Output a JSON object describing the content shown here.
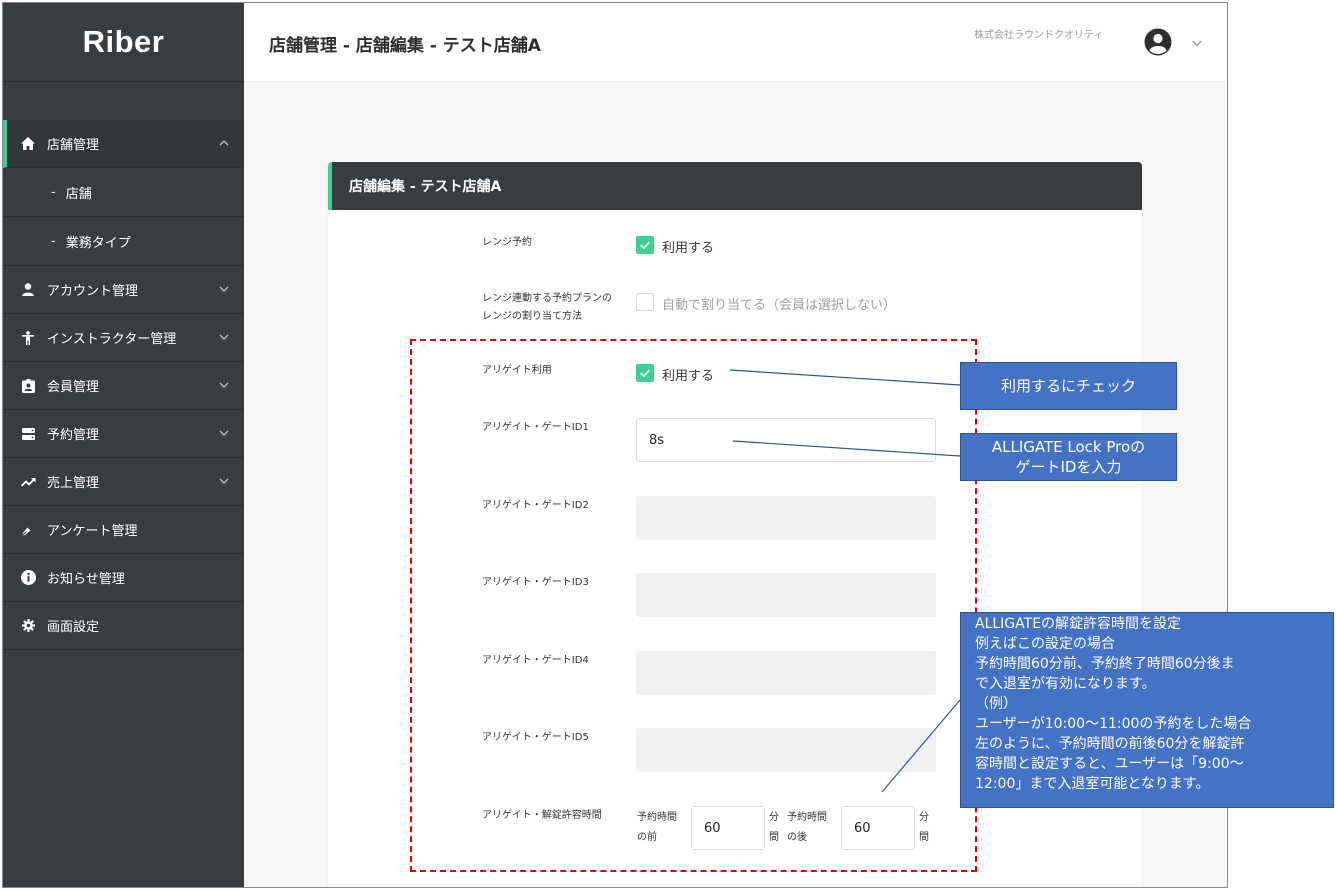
{
  "sidebar": {
    "brand": "Riber",
    "items": [
      {
        "label": "店舗管理",
        "icon": "home-icon"
      },
      {
        "label": "アカウント管理",
        "icon": "person-icon"
      },
      {
        "label": "インストラクター管理",
        "icon": "figure-icon"
      },
      {
        "label": "会員管理",
        "icon": "badge-icon"
      },
      {
        "label": "予約管理",
        "icon": "server-icon"
      },
      {
        "label": "売上管理",
        "icon": "trend-icon"
      },
      {
        "label": "アンケート管理",
        "icon": "pen-icon"
      },
      {
        "label": "お知らせ管理",
        "icon": "info-icon"
      },
      {
        "label": "画面設定",
        "icon": "gear-icon"
      }
    ],
    "sub_items": [
      {
        "dash": "-",
        "label": "店舗"
      },
      {
        "dash": "-",
        "label": "業務タイプ"
      }
    ]
  },
  "header": {
    "title": "店舗管理 - 店舗編集 - テスト店舗A",
    "company": "株式会社ラウンドクオリティ"
  },
  "card": {
    "title": "店舗編集 - テスト店舗A",
    "range_booking": {
      "label": "レンジ予約",
      "checked": true,
      "text": "利用する"
    },
    "range_plan": {
      "label_line1": "レンジ連動する予約プランの",
      "label_line2": "レンジの割り当て方法",
      "checked": false,
      "text": "自動で割り当てる（会員は選択しない）"
    },
    "alligate_use": {
      "label": "アリゲイト利用",
      "checked": true,
      "text": "利用する"
    },
    "gate_ids": [
      {
        "label": "アリゲイト・ゲートID1",
        "value": "8s"
      },
      {
        "label": "アリゲイト・ゲートID2",
        "value": ""
      },
      {
        "label": "アリゲイト・ゲートID3",
        "value": ""
      },
      {
        "label": "アリゲイト・ゲートID4",
        "value": ""
      },
      {
        "label": "アリゲイト・ゲートID5",
        "value": ""
      }
    ],
    "unlock_time": {
      "label": "アリゲイト・解錠許容時間",
      "before_label_1": "予約時間",
      "before_label_2": "の前",
      "before_value": "60",
      "unit_1": "分",
      "unit_2": "間",
      "after_label_1": "予約時間",
      "after_label_2": "の後",
      "after_value": "60"
    }
  },
  "annotations": {
    "check_note": "利用するにチェック",
    "gate_note_1": "ALLIGATE Lock Proの",
    "gate_note_2": "ゲートIDを入力",
    "time_note": [
      "ALLIGATEの解錠許容時間を設定",
      "例えばこの設定の場合",
      "予約時間60分前、予約終了時間60分後ま",
      "で入退室が有効になります。",
      "（例）",
      "ユーザーが10:00〜11:00の予約をした場合",
      "左のように、予約時間の前後60分を解錠許",
      "容時間と設定すると、ユーザーは「9:00〜",
      "12:00」まで入退室可能となります。"
    ]
  },
  "colors": {
    "accent": "#3ecf8e",
    "sidebar": "#3a3d40",
    "callout": "#4472c4",
    "dashed": "#e00000"
  }
}
